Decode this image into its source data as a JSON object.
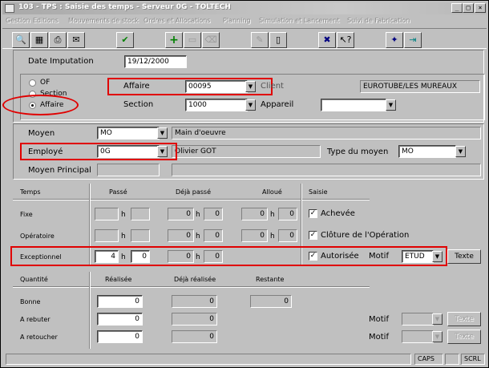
{
  "window": {
    "title": "103 - TPS : Saisie des temps - Serveur 0G - TOLTECH"
  },
  "menu": [
    "Gestion",
    "Editions",
    "Mouvements de stock",
    "Ordres et Allocations",
    "Planning",
    "Simulation et Lancement",
    "Suivi de Fabrication"
  ],
  "header": {
    "date_label": "Date Imputation",
    "date_value": "19/12/2000",
    "radio_of": "OF",
    "radio_section": "Section",
    "radio_affaire": "Affaire",
    "affaire_label": "Affaire",
    "affaire_value": "00095",
    "client_label": "Client",
    "client_value": "EUROTUBE/LES MUREAUX",
    "section_label": "Section",
    "section_value": "1000",
    "appareil_label": "Appareil",
    "appareil_value": ""
  },
  "moyen": {
    "moyen_label": "Moyen",
    "moyen_value": "MO",
    "moyen_desc": "Main d'oeuvre",
    "employe_label": "Employé",
    "employe_value": "0G",
    "employe_desc": "Olivier GOT",
    "type_label": "Type du moyen",
    "type_value": "MO",
    "principal_label": "Moyen Principal",
    "principal_value": "",
    "principal_desc": ""
  },
  "temps": {
    "headers": {
      "temps": "Temps",
      "passe": "Passé",
      "deja": "Déjà passé",
      "alloue": "Alloué",
      "saisie": "Saisie"
    },
    "h": "h",
    "fixe": {
      "label": "Fixe",
      "passe_h": "",
      "passe_m": "",
      "deja_h": "0",
      "deja_m": "0",
      "alloue_h": "0",
      "alloue_m": "0",
      "check_label": "Achevée",
      "checked": "✓"
    },
    "operatoire": {
      "label": "Opératoire",
      "passe_h": "",
      "passe_m": "",
      "deja_h": "0",
      "deja_m": "0",
      "alloue_h": "0",
      "alloue_m": "0",
      "check_label": "Clôture de l'Opération",
      "checked": "✓"
    },
    "exceptionnel": {
      "label": "Exceptionnel",
      "passe_h": "4",
      "passe_m": "0",
      "deja_h": "0",
      "deja_m": "0",
      "check_label": "Autorisée",
      "checked": "✓",
      "motif_label": "Motif",
      "motif_value": "ETUD",
      "texte_btn": "Texte"
    }
  },
  "quantite": {
    "headers": {
      "quantite": "Quantité",
      "realisee": "Réalisée",
      "deja": "Déjà réalisée",
      "restante": "Restante"
    },
    "bonne": {
      "label": "Bonne",
      "realisee": "0",
      "deja": "0",
      "restante": "0"
    },
    "rebuter": {
      "label": "A rebuter",
      "realisee": "0",
      "deja": "0",
      "motif_label": "Motif",
      "texte_btn": "Texte"
    },
    "retoucher": {
      "label": "A retoucher",
      "realisee": "0",
      "deja": "0",
      "motif_label": "Motif",
      "texte_btn": "Texte"
    }
  },
  "status": {
    "caps": "CAPS",
    "scrl": "SCRL"
  }
}
